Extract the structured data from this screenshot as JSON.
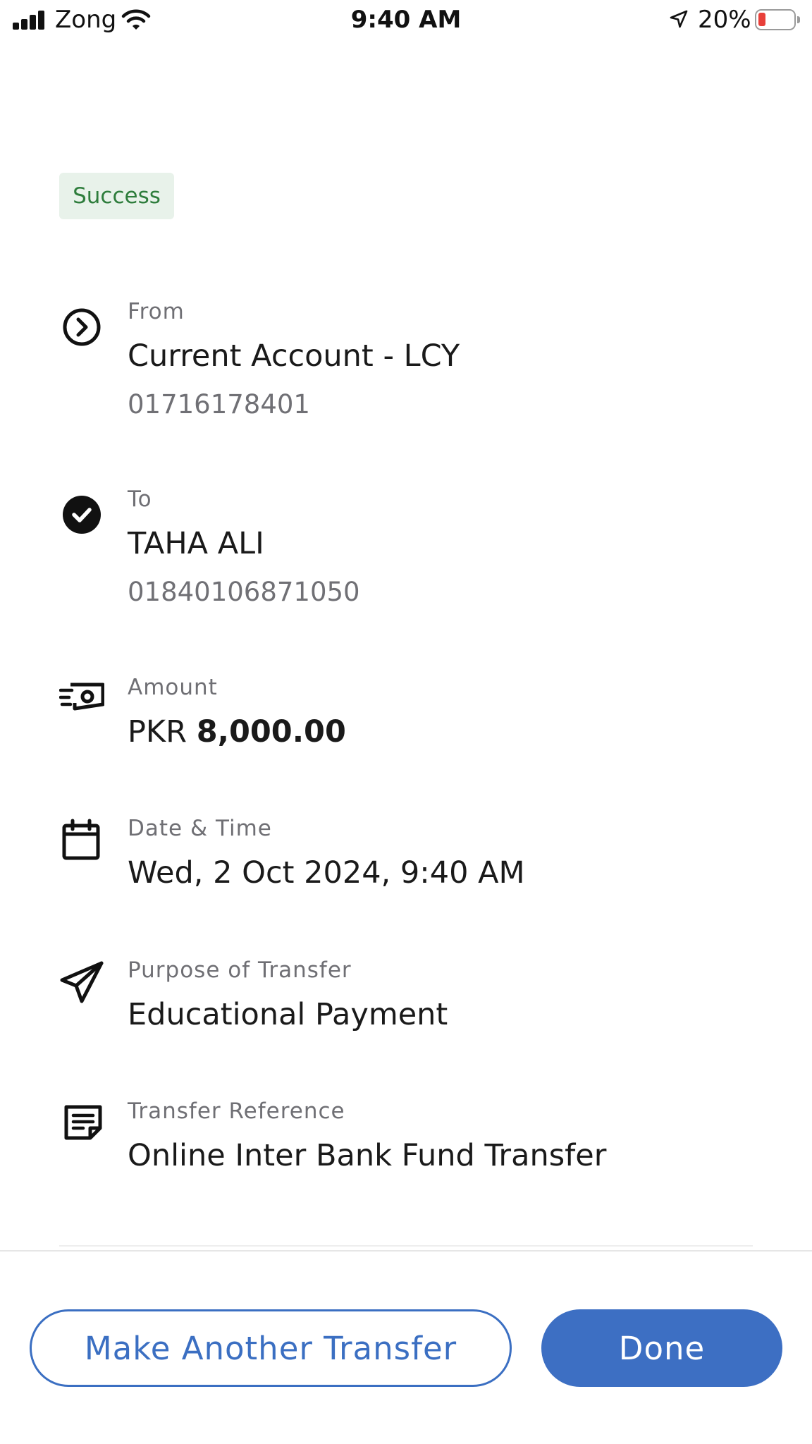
{
  "status_bar": {
    "carrier": "Zong",
    "time": "9:40 AM",
    "battery_percent": "20%",
    "battery_level": 0.2,
    "battery_color": "#e8403a",
    "icons": [
      "signal-bars-icon",
      "wifi-icon",
      "location-arrow-icon",
      "battery-icon"
    ]
  },
  "transfer": {
    "status": "Success",
    "status_color": "#2e7d3c",
    "from": {
      "icon": "chevron-right-circle-icon",
      "label": "From",
      "account_name": "Current Account - LCY",
      "account_number": "01716178401"
    },
    "to": {
      "icon": "check-circle-icon",
      "label": "To",
      "name": "TAHA ALI",
      "account_number": "01840106871050"
    },
    "amount": {
      "icon": "cash-icon",
      "label": "Amount",
      "currency": "PKR",
      "value": "8,000.00"
    },
    "datetime": {
      "icon": "calendar-icon",
      "label": "Date & Time",
      "value": "Wed, 2 Oct 2024, 9:40 AM"
    },
    "purpose": {
      "icon": "paper-plane-icon",
      "label": "Purpose of Transfer",
      "value": "Educational Payment"
    },
    "reference": {
      "icon": "note-icon",
      "label": "Transfer Reference",
      "value": "Online Inter Bank Fund Transfer"
    }
  },
  "actions": {
    "make_another_label": "Make Another Transfer",
    "done_label": "Done",
    "accent_color": "#3d6fc3"
  }
}
